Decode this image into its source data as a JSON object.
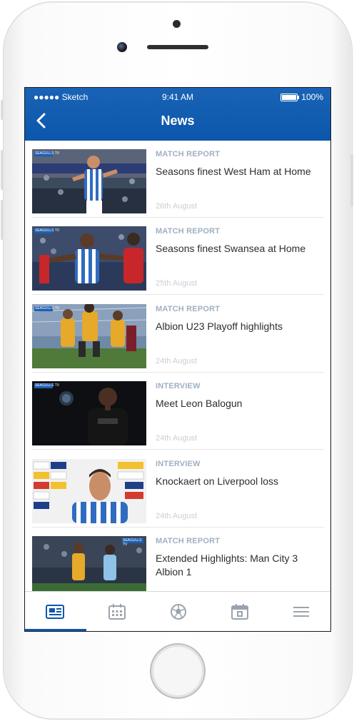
{
  "status_bar": {
    "carrier": "●●●●● Sketch",
    "time": "9:41 AM",
    "battery": "100%"
  },
  "header": {
    "title": "News",
    "back_icon": "chevron-left-icon"
  },
  "articles": [
    {
      "category": "MATCH REPORT",
      "title": "Seasons finest West Ham at Home",
      "date": "26th August",
      "thumb_badge": "SEAGULLS TV"
    },
    {
      "category": "MATCH REPORT",
      "title": "Seasons finest Swansea at Home",
      "date": "25th August",
      "thumb_badge": "SEAGULLS TV"
    },
    {
      "category": "MATCH REPORT",
      "title": "Albion U23 Playoff highlights",
      "date": "24th August",
      "thumb_badge": "SEAGULLS TV"
    },
    {
      "category": "INTERVIEW",
      "title": "Meet Leon Balogun",
      "date": "24th August",
      "thumb_badge": "SEAGULLS TV"
    },
    {
      "category": "INTERVIEW",
      "title": "Knockaert on Liverpool loss",
      "date": "24th August",
      "thumb_badge": ""
    },
    {
      "category": "MATCH REPORT",
      "title": "Extended Highlights: Man City 3 Albion 1",
      "date": "",
      "thumb_badge": "SEAGULLS TV"
    }
  ],
  "tabbar": {
    "items": [
      {
        "name": "news",
        "icon": "newspaper-icon",
        "active": true
      },
      {
        "name": "fixtures",
        "icon": "calendar-grid-icon",
        "active": false
      },
      {
        "name": "match",
        "icon": "football-icon",
        "active": false
      },
      {
        "name": "events",
        "icon": "calendar-icon",
        "active": false
      },
      {
        "name": "menu",
        "icon": "hamburger-menu-icon",
        "active": false
      }
    ]
  },
  "colors": {
    "brand_blue": "#0b57ab",
    "category_text": "#9fb0c2",
    "date_text": "#c8cfd6",
    "icon_inactive": "#9aa3ad"
  }
}
